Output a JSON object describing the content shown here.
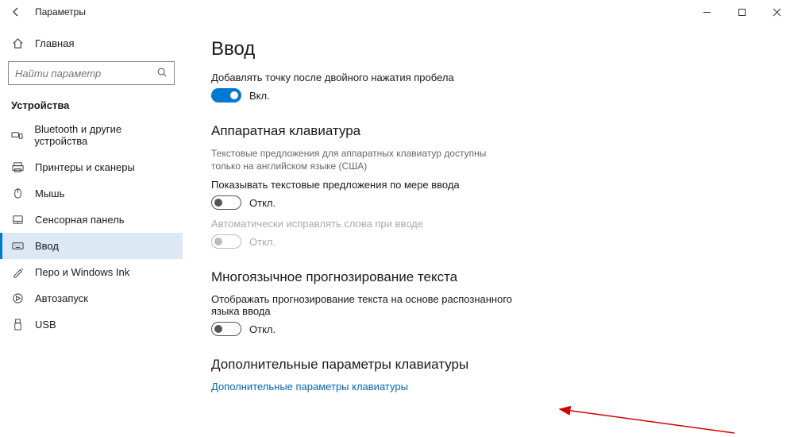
{
  "titlebar": {
    "title": "Параметры"
  },
  "sidebar": {
    "home_label": "Главная",
    "search_placeholder": "Найти параметр",
    "section_title": "Устройства",
    "items": [
      {
        "label": "Bluetooth и другие устройства"
      },
      {
        "label": "Принтеры и сканеры"
      },
      {
        "label": "Мышь"
      },
      {
        "label": "Сенсорная панель"
      },
      {
        "label": "Ввод"
      },
      {
        "label": "Перо и Windows Ink"
      },
      {
        "label": "Автозапуск"
      },
      {
        "label": "USB"
      }
    ]
  },
  "content": {
    "h1": "Ввод",
    "opt1_label": "Добавлять точку после двойного нажатия пробела",
    "on_label": "Вкл.",
    "off_label": "Откл.",
    "sec_hw": "Аппаратная клавиатура",
    "hw_desc": "Текстовые предложения для аппаратных клавиатур доступны только на английском языке (США)",
    "hw_opt1": "Показывать текстовые предложения по мере ввода",
    "hw_opt2": "Автоматически исправлять слова при вводе",
    "sec_multi": "Многоязычное прогнозирование текста",
    "multi_opt": "Отображать прогнозирование текста на основе распознанного языка ввода",
    "sec_extra": "Дополнительные параметры клавиатуры",
    "extra_link": "Дополнительные параметры клавиатуры"
  }
}
